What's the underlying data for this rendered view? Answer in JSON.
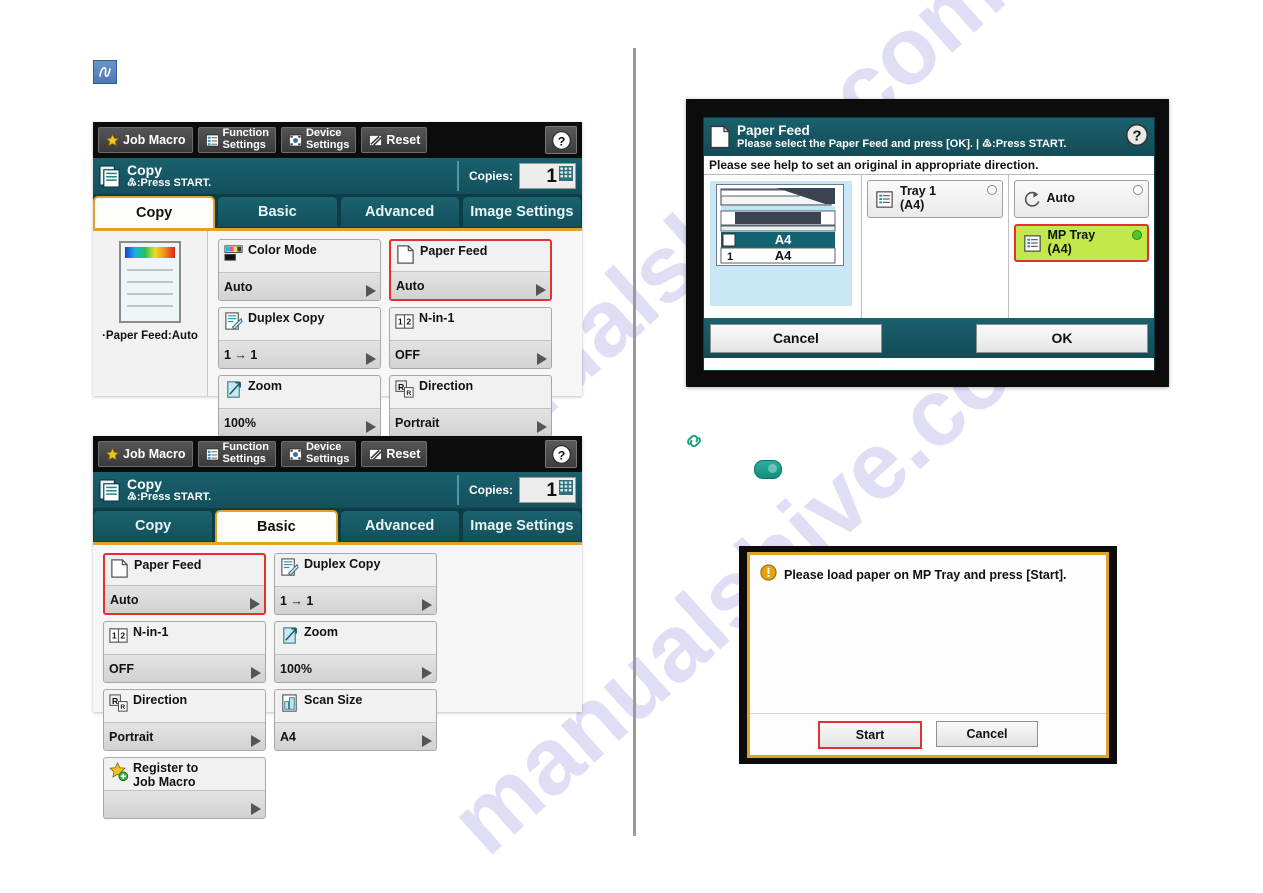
{
  "watermark": {
    "text": "manualshive.com"
  },
  "memo_icon": {
    "name": "memo-pen-icon"
  },
  "toolbar": {
    "job_macro": "Job Macro",
    "function_settings_l1": "Function",
    "function_settings_l2": "Settings",
    "device_settings_l1": "Device",
    "device_settings_l2": "Settings",
    "reset": "Reset",
    "help": "?"
  },
  "status": {
    "title": "Copy",
    "subtitle": "♳:Press START.",
    "copies_label": "Copies:",
    "copies_value": "1"
  },
  "panel1": {
    "tabs": [
      {
        "label": "Copy",
        "active": true
      },
      {
        "label": "Basic",
        "active": false
      },
      {
        "label": "Advanced",
        "active": false
      },
      {
        "label": "Image Settings",
        "active": false
      }
    ],
    "preview_caption": "·Paper Feed:Auto",
    "tiles": [
      {
        "label": "Color Mode",
        "value": "Auto",
        "icon": "color-mode-icon",
        "selected": false
      },
      {
        "label": "Paper Feed",
        "value": "Auto",
        "icon": "paper-feed-icon",
        "selected": true
      },
      {
        "label": "Duplex Copy",
        "value": "1 → 1",
        "icon": "duplex-copy-icon",
        "selected": false
      },
      {
        "label": "N-in-1",
        "value": "OFF",
        "icon": "n-in-1-icon",
        "selected": false
      },
      {
        "label": "Zoom",
        "value": "100%",
        "icon": "zoom-icon",
        "selected": false
      },
      {
        "label": "Direction",
        "value": "Portrait",
        "icon": "direction-icon",
        "selected": false
      }
    ]
  },
  "panel2": {
    "tabs": [
      {
        "label": "Copy",
        "active": false
      },
      {
        "label": "Basic",
        "active": true
      },
      {
        "label": "Advanced",
        "active": false
      },
      {
        "label": "Image Settings",
        "active": false
      }
    ],
    "tiles": [
      {
        "label": "Paper Feed",
        "value": "Auto",
        "icon": "paper-feed-icon",
        "selected": true
      },
      {
        "label": "Duplex Copy",
        "value": "1 → 1",
        "icon": "duplex-copy-icon",
        "selected": false
      },
      {
        "label": "N-in-1",
        "value": "OFF",
        "icon": "n-in-1-icon",
        "selected": false
      },
      {
        "label": "Zoom",
        "value": "100%",
        "icon": "zoom-icon",
        "selected": false
      },
      {
        "label": "Direction",
        "value": "Portrait",
        "icon": "direction-icon",
        "selected": false
      },
      {
        "label": "Scan Size",
        "value": "A4",
        "icon": "scan-size-icon",
        "selected": false
      },
      {
        "label": "Register to\nJob Macro",
        "value": "",
        "icon": "job-macro-star-icon",
        "selected": false
      }
    ]
  },
  "paper_feed_dialog": {
    "title": "Paper Feed",
    "subtitle": "Please select the Paper Feed and press [OK]. | ♳:Press START.",
    "note": "Please see help to set an original in appropriate direction.",
    "printer_graphic": {
      "upper_size": "A4",
      "tray_number": "1",
      "tray_size": "A4"
    },
    "options_left": [
      {
        "label_l1": "Tray 1",
        "label_l2": "(A4)",
        "selected": false,
        "icon": "tray-icon"
      }
    ],
    "options_right": [
      {
        "label_l1": "Auto",
        "label_l2": "",
        "selected": false,
        "icon": "auto-icon"
      },
      {
        "label_l1": "MP Tray",
        "label_l2": "(A4)",
        "selected": true,
        "icon": "tray-icon"
      }
    ],
    "cancel": "Cancel",
    "ok": "OK"
  },
  "link_icon": {
    "name": "chain-link-icon"
  },
  "pill_icon": {
    "name": "teal-pill-button-icon"
  },
  "message_dialog": {
    "icon": "warning-icon",
    "text": "Please load paper on MP Tray and press [Start].",
    "start": "Start",
    "cancel": "Cancel"
  },
  "colors": {
    "teal": "#19606d",
    "black_bar": "#0c0c0c",
    "accent_gold": "#e0a22a",
    "select_red": "#e33030",
    "mp_green": "#c3e84a",
    "link_green": "#18a07a"
  }
}
